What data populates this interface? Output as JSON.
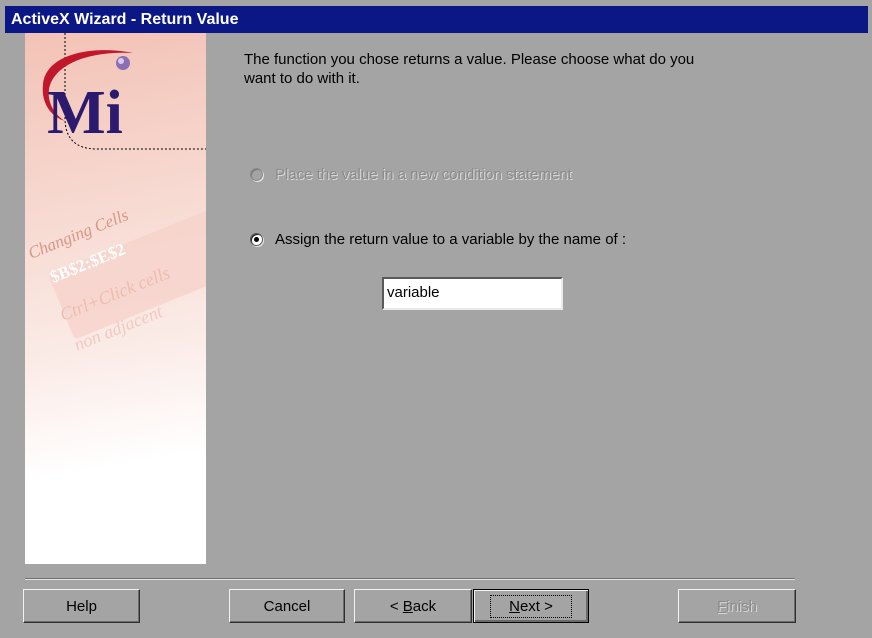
{
  "window": {
    "title": "ActiveX Wizard - Return Value"
  },
  "sidepanel": {
    "decor_text_1": "Changing Cells",
    "decor_text_2": "$B$2:$E$2",
    "decor_text_3": "Ctrl+Click cells",
    "decor_text_4": "non adjacent",
    "logo_letters": "Mi"
  },
  "main": {
    "description": "The function you chose returns a value. Please choose what do you want to do with it.",
    "options": [
      {
        "label": "Place the value in a new condition statement",
        "enabled": false,
        "selected": false
      },
      {
        "label": "Assign the return value to a variable by the name of :",
        "enabled": true,
        "selected": true
      }
    ],
    "variable_value": "variable"
  },
  "buttons": {
    "help": "Help",
    "cancel": "Cancel",
    "back_prefix": "< ",
    "back_key": "B",
    "back_rest": "ack",
    "next_key": "N",
    "next_rest": "ext >",
    "finish_key": "F",
    "finish_rest": "inish"
  },
  "colors": {
    "titlebar": "#0a1784",
    "dialog_bg": "#a4a4a4",
    "logo_red": "#c0182a",
    "logo_purple": "#2b1a6e"
  }
}
